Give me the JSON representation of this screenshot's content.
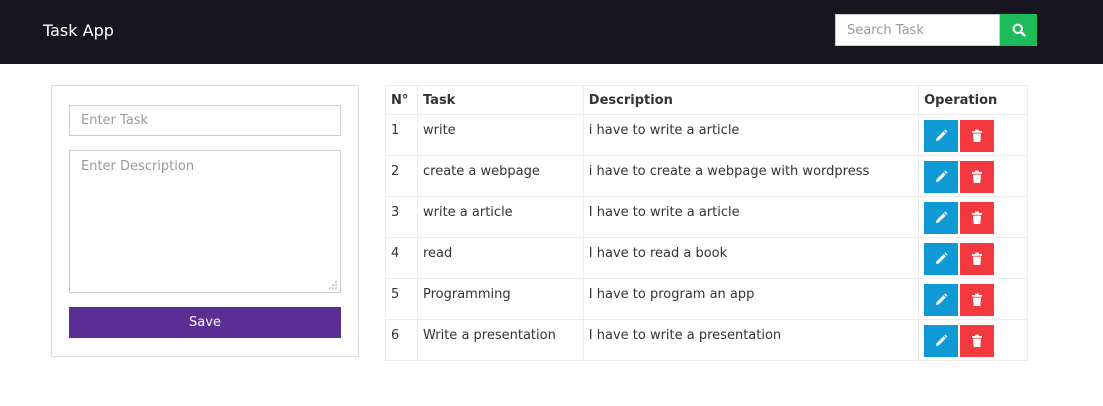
{
  "navbar": {
    "brand": "Task App",
    "search": {
      "placeholder": "Search Task",
      "value": ""
    },
    "search_button_icon": "search-icon"
  },
  "form": {
    "task_placeholder": "Enter Task",
    "description_placeholder": "Enter Description",
    "save_label": "Save"
  },
  "table": {
    "headers": {
      "n": "N°",
      "task": "Task",
      "description": "Description",
      "operation": "Operation"
    },
    "rows": [
      {
        "n": "1",
        "task": "write",
        "description": "i have to write a article"
      },
      {
        "n": "2",
        "task": "create a webpage",
        "description": "i have to create a webpage with wordpress"
      },
      {
        "n": "3",
        "task": "write a article",
        "description": "I have to write a article"
      },
      {
        "n": "4",
        "task": "read",
        "description": "I have to read a book"
      },
      {
        "n": "5",
        "task": "Programming",
        "description": "I have to program an app"
      },
      {
        "n": "6",
        "task": "Write a presentation",
        "description": "I have to write a presentation"
      }
    ],
    "edit_icon": "pencil-icon",
    "delete_icon": "trash-icon"
  },
  "colors": {
    "navbar_bg": "#17151f",
    "search_button": "#1dbb5a",
    "save_button": "#5b2e96",
    "edit_button": "#0f9ad6",
    "delete_button": "#f2393f"
  }
}
